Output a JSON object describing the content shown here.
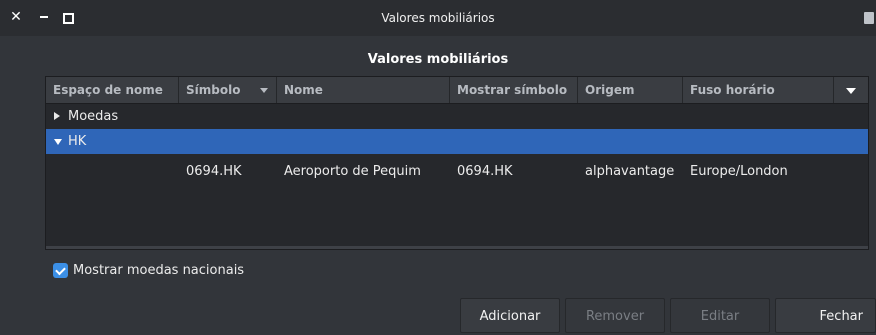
{
  "window": {
    "title": "Valores mobiliários",
    "controls": {
      "close_icon": "close-icon",
      "minimize_icon": "minimize-icon",
      "maximize_icon": "maximize-icon"
    }
  },
  "dialog": {
    "heading": "Valores mobiliários"
  },
  "table": {
    "columns": [
      "Espaço de nome",
      "Símbolo",
      "Nome",
      "Mostrar símbolo",
      "Origem",
      "Fuso horário"
    ],
    "sorted_column": "Símbolo",
    "groups": [
      {
        "label": "Moedas",
        "expanded": false,
        "rows": []
      },
      {
        "label": "HK",
        "expanded": true,
        "selected": true,
        "rows": [
          {
            "namespace": "",
            "symbol": "0694.HK",
            "name": "Aeroporto de Pequim",
            "display_symbol": "0694.HK",
            "source": "alphavantage",
            "timezone": "Europe/London"
          }
        ]
      }
    ]
  },
  "options": {
    "show_national_currencies": {
      "label": "Mostrar moedas nacionais",
      "checked": true
    }
  },
  "buttons": {
    "add": "Adicionar",
    "remove": "Remover",
    "edit": "Editar",
    "close": "Fechar"
  },
  "colors": {
    "selection": "#2f66b8",
    "checkbox_accent": "#3b8fe6",
    "background": "#32353a"
  }
}
